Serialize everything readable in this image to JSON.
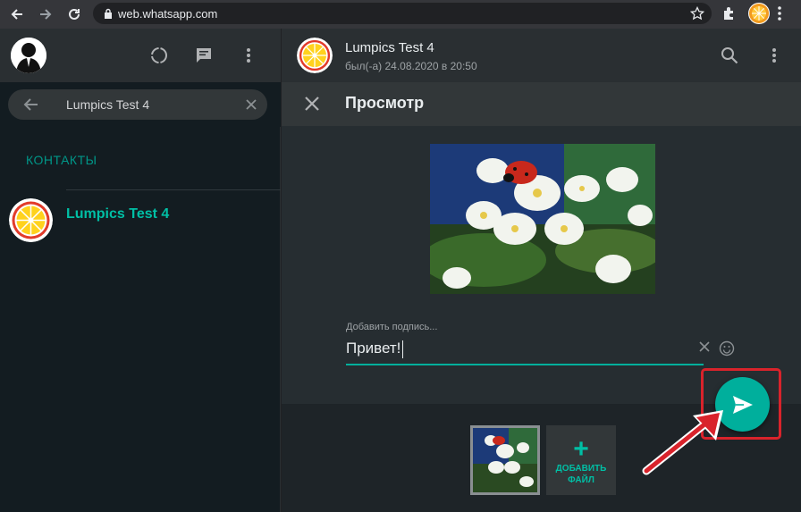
{
  "browser": {
    "url": "web.whatsapp.com"
  },
  "sidebar": {
    "search": {
      "value": "Lumpics Test 4"
    },
    "section_title": "КОНТАКТЫ",
    "contacts": [
      {
        "name": "Lumpics Test 4"
      }
    ]
  },
  "chat": {
    "title": "Lumpics Test 4",
    "last_seen": "был(-а) 24.08.2020 в 20:50"
  },
  "preview": {
    "title": "Просмотр",
    "caption_label": "Добавить подпись...",
    "caption_value": "Привет!",
    "add_file_plus": "+",
    "add_file_label_1": "ДОБАВИТЬ",
    "add_file_label_2": "ФАЙЛ"
  },
  "colors": {
    "accent": "#00af9c",
    "accent_text": "#00bfa5",
    "highlight": "#d9232b"
  },
  "icons": {
    "back": "arrow-left-icon",
    "forward": "arrow-right-icon",
    "reload": "reload-icon",
    "lock": "lock-icon",
    "star": "star-icon",
    "extensions": "puzzle-icon",
    "status": "status-ring-icon",
    "new_chat": "chat-icon",
    "menu": "kebab-menu-icon",
    "search": "search-icon",
    "close": "close-icon",
    "emoji": "emoji-icon",
    "send": "send-icon"
  }
}
